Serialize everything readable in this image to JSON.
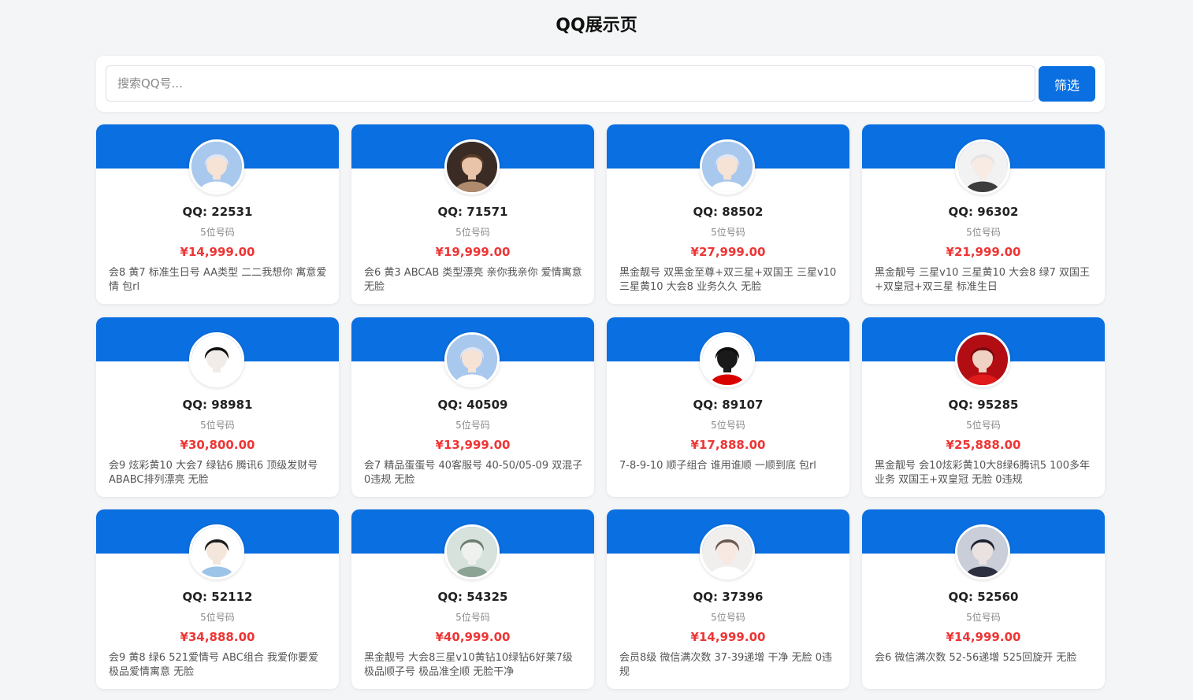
{
  "page": {
    "title": "QQ展示页"
  },
  "search": {
    "placeholder": "搜索QQ号...",
    "value": "",
    "button_label": "筛选"
  },
  "colors": {
    "accent": "#0a6fe0",
    "price": "#ee3535"
  },
  "cards": [
    {
      "qq": "QQ: 22531",
      "digits": "5位号码",
      "price": "¥14,999.00",
      "desc": "会8 黄7 标准生日号 AA类型 二二我想你 寓意爱情 包rl",
      "avatar": {
        "bg": "#a9c8ee",
        "hair": "#dfe6f2",
        "skin": "#f6e3d6",
        "cloth": "#ffffff"
      }
    },
    {
      "qq": "QQ: 71571",
      "digits": "5位号码",
      "price": "¥19,999.00",
      "desc": "会6 黄3 ABCAB 类型漂亮 亲你我亲你 爱情寓意 无脸",
      "avatar": {
        "bg": "#3a2c24",
        "hair": "#5a3b28",
        "skin": "#e9c4a8",
        "cloth": "#b08a6c"
      }
    },
    {
      "qq": "QQ: 88502",
      "digits": "5位号码",
      "price": "¥27,999.00",
      "desc": "黑金靓号 双黑金至尊+双三星+双国王 三星v10 三星黄10 大会8 业务久久 无脸",
      "avatar": {
        "bg": "#a9c8ee",
        "hair": "#dfe6f2",
        "skin": "#f6e3d6",
        "cloth": "#ffffff"
      }
    },
    {
      "qq": "QQ: 96302",
      "digits": "5位号码",
      "price": "¥21,999.00",
      "desc": "黑金靓号 三星v10 三星黄10 大会8 绿7 双国王+双皇冠+双三星 标准生日",
      "avatar": {
        "bg": "#f2f2f2",
        "hair": "#e4e4e4",
        "skin": "#f7ebe4",
        "cloth": "#3d3d3d"
      }
    },
    {
      "qq": "QQ: 98981",
      "digits": "5位号码",
      "price": "¥30,800.00",
      "desc": "会9 炫彩黄10 大会7 绿钻6 腾讯6 顶级发财号 ABABC排列漂亮 无脸",
      "avatar": {
        "bg": "#ffffff",
        "hair": "#111111",
        "skin": "#f2ece8",
        "cloth": "#ffffff"
      }
    },
    {
      "qq": "QQ: 40509",
      "digits": "5位号码",
      "price": "¥13,999.00",
      "desc": "会7 精品蛋蛋号 40客服号 40-50/05-09 双混子 0违规 无脸",
      "avatar": {
        "bg": "#a9c8ee",
        "hair": "#dfe6f2",
        "skin": "#f6e3d6",
        "cloth": "#ffffff"
      }
    },
    {
      "qq": "QQ: 89107",
      "digits": "5位号码",
      "price": "¥17,888.00",
      "desc": "7-8-9-10 顺子组合 谁用谁顺 一顺到底 包rl",
      "avatar": {
        "bg": "#ffffff",
        "hair": "#0d0d0d",
        "skin": "#1a1a1a",
        "cloth": "#d90000"
      }
    },
    {
      "qq": "QQ: 95285",
      "digits": "5位号码",
      "price": "¥25,888.00",
      "desc": "黑金靓号 会10炫彩黄10大8绿6腾讯5 100多年业务 双国王+双皇冠 无脸 0违规",
      "avatar": {
        "bg": "#b30d14",
        "hair": "#7a0a0e",
        "skin": "#f0d2c4",
        "cloth": "#e01a1a"
      }
    },
    {
      "qq": "QQ: 52112",
      "digits": "5位号码",
      "price": "¥34,888.00",
      "desc": "会9 黄8 绿6 521爱情号 ABC组合 我爱你要爱 极品爱情寓意 无脸",
      "avatar": {
        "bg": "#ffffff",
        "hair": "#1c1c1c",
        "skin": "#f5e6dc",
        "cloth": "#9cc3e8"
      }
    },
    {
      "qq": "QQ: 54325",
      "digits": "5位号码",
      "price": "¥40,999.00",
      "desc": "黑金靓号 大会8三星v10黄钻10绿钻6好莱7级 极品顺子号 极品准全顺 无脸干净",
      "avatar": {
        "bg": "#d8e2dc",
        "hair": "#6e7e72",
        "skin": "#eef1ee",
        "cloth": "#8aa393"
      }
    },
    {
      "qq": "QQ: 37396",
      "digits": "5位号码",
      "price": "¥14,999.00",
      "desc": "会员8级 微信满次数 37-39递增 干净 无脸 0违规",
      "avatar": {
        "bg": "#f1eeee",
        "hair": "#6b5a52",
        "skin": "#f7e9e2",
        "cloth": "#ffffff"
      }
    },
    {
      "qq": "QQ: 52560",
      "digits": "5位号码",
      "price": "¥14,999.00",
      "desc": "会6 微信满次数 52-56递增 525回旋开 无脸",
      "avatar": {
        "bg": "#c9ced8",
        "hair": "#1e2230",
        "skin": "#e9e2e0",
        "cloth": "#2b2f40"
      }
    }
  ]
}
